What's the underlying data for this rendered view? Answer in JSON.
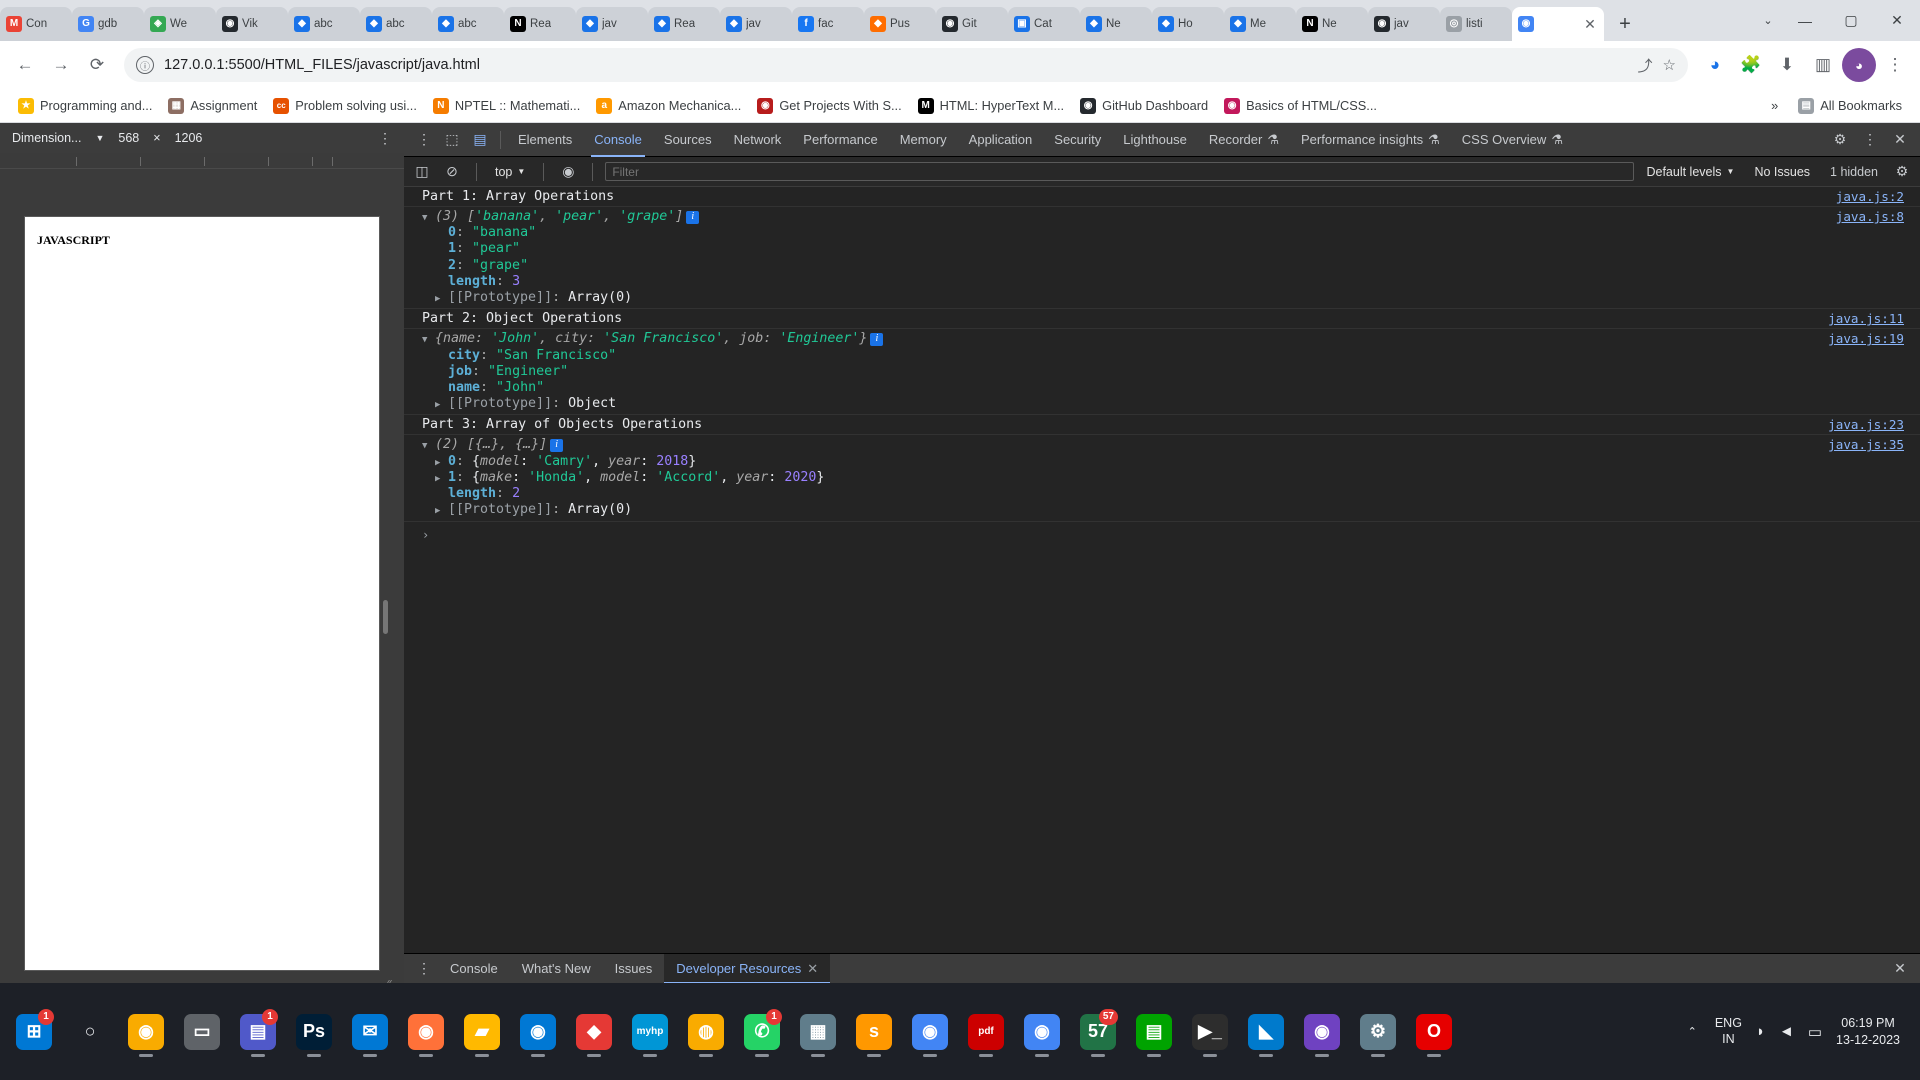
{
  "browser": {
    "tabs": [
      {
        "label": "Con",
        "icon": "M",
        "icon_color": "#ea4335",
        "active": false
      },
      {
        "label": "gdb",
        "icon": "G",
        "icon_color": "#4285f4",
        "active": false
      },
      {
        "label": "We",
        "icon": "◈",
        "icon_color": "#34a853",
        "active": false
      },
      {
        "label": "Vik",
        "icon": "◉",
        "icon_color": "#24292e",
        "active": false
      },
      {
        "label": "abc",
        "icon": "◆",
        "icon_color": "#1a73e8",
        "active": false
      },
      {
        "label": "abc",
        "icon": "◆",
        "icon_color": "#1a73e8",
        "active": false
      },
      {
        "label": "abc",
        "icon": "◆",
        "icon_color": "#1a73e8",
        "active": false
      },
      {
        "label": "Rea",
        "icon": "N",
        "icon_color": "#000000",
        "active": false
      },
      {
        "label": "jav",
        "icon": "◆",
        "icon_color": "#1a73e8",
        "active": false
      },
      {
        "label": "Rea",
        "icon": "◆",
        "icon_color": "#1a73e8",
        "active": false
      },
      {
        "label": "jav",
        "icon": "◆",
        "icon_color": "#1a73e8",
        "active": false
      },
      {
        "label": "fac",
        "icon": "f",
        "icon_color": "#1877f2",
        "active": false
      },
      {
        "label": "Pus",
        "icon": "◆",
        "icon_color": "#ff6d00",
        "active": false
      },
      {
        "label": "Git",
        "icon": "◉",
        "icon_color": "#24292e",
        "active": false
      },
      {
        "label": "Cat",
        "icon": "▣",
        "icon_color": "#1a73e8",
        "active": false
      },
      {
        "label": "Ne",
        "icon": "◆",
        "icon_color": "#1a73e8",
        "active": false
      },
      {
        "label": "Ho",
        "icon": "◆",
        "icon_color": "#1a73e8",
        "active": false
      },
      {
        "label": "Me",
        "icon": "◆",
        "icon_color": "#1a73e8",
        "active": false
      },
      {
        "label": "Ne",
        "icon": "N",
        "icon_color": "#000000",
        "active": false
      },
      {
        "label": "jav",
        "icon": "◉",
        "icon_color": "#24292e",
        "active": false
      },
      {
        "label": "listi",
        "icon": "◎",
        "icon_color": "#9aa0a6",
        "active": false
      },
      {
        "label": "",
        "icon": "◉",
        "icon_color": "#4285f4",
        "active": true
      }
    ],
    "new_tab_label": "+",
    "tab_close_label": "✕",
    "tab_search_caret": "⌄",
    "window_controls": {
      "minimize": "—",
      "maximize": "▢",
      "close": "✕"
    },
    "nav": {
      "back": "←",
      "forward": "→",
      "reload": "⟳"
    },
    "omnibox": {
      "url": "127.0.0.1:5500/HTML_FILES/javascript/java.html",
      "lock_icon": "ⓘ",
      "share_icon": "⤴",
      "star_icon": "☆",
      "profile_icon": "◕",
      "extensions_icon": "🧩",
      "download_icon": "⬇",
      "sidepanel_icon": "▥",
      "menu_icon": "⋮"
    },
    "bookmarks": [
      {
        "label": "Programming and...",
        "icon": "★",
        "color": "#fbbc04"
      },
      {
        "label": "Assignment",
        "icon": "▦",
        "color": "#8d6e63"
      },
      {
        "label": "Problem solving usi...",
        "icon": "cc",
        "color": "#e65100"
      },
      {
        "label": "NPTEL :: Mathemati...",
        "icon": "N",
        "color": "#f57c00"
      },
      {
        "label": "Amazon Mechanica...",
        "icon": "a",
        "color": "#ff9900"
      },
      {
        "label": "Get Projects With S...",
        "icon": "◉",
        "color": "#b71c1c"
      },
      {
        "label": "HTML: HyperText M...",
        "icon": "M",
        "color": "#000000"
      },
      {
        "label": "GitHub Dashboard",
        "icon": "◉",
        "color": "#24292e"
      },
      {
        "label": "Basics of HTML/CSS...",
        "icon": "◉",
        "color": "#c2185b"
      }
    ],
    "bookmarks_overflow": "»",
    "all_bookmarks_label": "All Bookmarks"
  },
  "device_toolbar": {
    "dimension_label": "Dimension...",
    "caret": "▼",
    "width": "568",
    "times": "×",
    "height": "1206",
    "kebab": "⋮"
  },
  "viewport": {
    "heading": "JAVASCRIPT"
  },
  "devtools": {
    "inspect_icon": "⬚",
    "device_icon": "▤",
    "tabs": [
      {
        "label": "Elements",
        "active": false
      },
      {
        "label": "Console",
        "active": true
      },
      {
        "label": "Sources",
        "active": false
      },
      {
        "label": "Network",
        "active": false
      },
      {
        "label": "Performance",
        "active": false
      },
      {
        "label": "Memory",
        "active": false
      },
      {
        "label": "Application",
        "active": false
      },
      {
        "label": "Security",
        "active": false
      },
      {
        "label": "Lighthouse",
        "active": false
      },
      {
        "label": "Recorder",
        "active": false,
        "badge": "⚗"
      },
      {
        "label": "Performance insights",
        "active": false,
        "badge": "⚗"
      },
      {
        "label": "CSS Overview",
        "active": false,
        "badge": "⚗"
      }
    ],
    "settings_icon": "⚙",
    "more_icon": "⋮",
    "close_icon": "✕",
    "filterbar": {
      "sidebar_icon": "◫",
      "clear_icon": "⊘",
      "context": "top",
      "context_caret": "▼",
      "eye_icon": "◉",
      "filter_placeholder": "Filter",
      "levels_label": "Default levels",
      "levels_caret": "▼",
      "issues_label": "No Issues",
      "hidden_label": "1 hidden",
      "hidden_gear": "⚙"
    },
    "console": {
      "prompt_arrow": "›",
      "arrow_down": "▼",
      "arrow_right": "▶",
      "info_badge": "i",
      "entries": [
        {
          "kind": "text",
          "text": "Part 1: Array Operations",
          "source": "java.js:2"
        },
        {
          "kind": "array",
          "header_count": "(3)",
          "header_preview": "['banana', 'pear', 'grape']",
          "source": "java.js:8",
          "items": [
            {
              "key": "0",
              "value": "\"banana\"",
              "vtype": "string"
            },
            {
              "key": "1",
              "value": "\"pear\"",
              "vtype": "string"
            },
            {
              "key": "2",
              "value": "\"grape\"",
              "vtype": "string"
            },
            {
              "key": "length",
              "value": "3",
              "vtype": "number"
            }
          ],
          "prototype_label": "[[Prototype]]",
          "prototype_value": "Array(0)"
        },
        {
          "kind": "text",
          "text": "Part 2: Object Operations",
          "source": "java.js:11"
        },
        {
          "kind": "object",
          "header_preview": "{name: 'John', city: 'San Francisco', job: 'Engineer'}",
          "source": "java.js:19",
          "items": [
            {
              "key": "city",
              "value": "\"San Francisco\"",
              "vtype": "string"
            },
            {
              "key": "job",
              "value": "\"Engineer\"",
              "vtype": "string"
            },
            {
              "key": "name",
              "value": "\"John\"",
              "vtype": "string"
            }
          ],
          "prototype_label": "[[Prototype]]",
          "prototype_value": "Object"
        },
        {
          "kind": "text",
          "text": "Part 3: Array of Objects Operations",
          "source": "java.js:23"
        },
        {
          "kind": "array_of_objects",
          "header_count": "(2)",
          "header_preview": "[{…}, {…}]",
          "source": "java.js:35",
          "rows": [
            {
              "key": "0",
              "preview": "{model: 'Camry', year: 2018}"
            },
            {
              "key": "1",
              "preview": "{make: 'Honda', model: 'Accord', year: 2020}"
            }
          ],
          "length_key": "length",
          "length_value": "2",
          "prototype_label": "[[Prototype]]",
          "prototype_value": "Array(0)"
        }
      ]
    },
    "drawer": {
      "kebab": "⋮",
      "tabs": [
        {
          "label": "Console",
          "active": false,
          "closable": false
        },
        {
          "label": "What's New",
          "active": false,
          "closable": false
        },
        {
          "label": "Issues",
          "active": false,
          "closable": false
        },
        {
          "label": "Developer Resources",
          "active": true,
          "closable": true
        }
      ],
      "close_icon": "✕",
      "drawer_close_icon": "✕"
    }
  },
  "taskbar": {
    "items": [
      {
        "name": "start-windows",
        "glyph": "⊞",
        "color": "#0078d4",
        "badge": "1",
        "running": false
      },
      {
        "name": "search",
        "glyph": "○",
        "color": "transparent",
        "running": false
      },
      {
        "name": "chrome-canary",
        "glyph": "◉",
        "color": "#f9ab00",
        "running": true
      },
      {
        "name": "task-view",
        "glyph": "▭",
        "color": "#5f6368",
        "running": false
      },
      {
        "name": "teams",
        "glyph": "▤",
        "color": "#5059c9",
        "badge": "1",
        "running": true
      },
      {
        "name": "photoshop",
        "glyph": "Ps",
        "color": "#001e36",
        "running": true
      },
      {
        "name": "mail",
        "glyph": "✉",
        "color": "#0078d4",
        "running": true
      },
      {
        "name": "firefox",
        "glyph": "◉",
        "color": "#ff7139",
        "running": true
      },
      {
        "name": "file-explorer",
        "glyph": "▰",
        "color": "#ffb900",
        "running": true
      },
      {
        "name": "edge",
        "glyph": "◉",
        "color": "#0078d4",
        "running": true
      },
      {
        "name": "gem-app",
        "glyph": "◆",
        "color": "#e53935",
        "running": true
      },
      {
        "name": "myhp",
        "glyph": "myhp",
        "color": "#0096d6",
        "running": true
      },
      {
        "name": "globe-app",
        "glyph": "◍",
        "color": "#f9ab00",
        "running": true
      },
      {
        "name": "whatsapp",
        "glyph": "✆",
        "color": "#25d366",
        "badge": "1",
        "running": true
      },
      {
        "name": "calculator",
        "glyph": "▦",
        "color": "#607d8b",
        "running": true
      },
      {
        "name": "sublime",
        "glyph": "s",
        "color": "#ff9800",
        "running": true
      },
      {
        "name": "chrome",
        "glyph": "◉",
        "color": "#4285f4",
        "running": true
      },
      {
        "name": "pdf-reader",
        "glyph": "pdf",
        "color": "#cc0000",
        "running": true
      },
      {
        "name": "chrome-active",
        "glyph": "◉",
        "color": "#4285f4",
        "running": true
      },
      {
        "name": "excel",
        "glyph": "57",
        "color": "#217346",
        "badge": "57",
        "running": true
      },
      {
        "name": "notes",
        "glyph": "▤",
        "color": "#00a300",
        "running": true
      },
      {
        "name": "terminal",
        "glyph": "▶_",
        "color": "#2d2d2d",
        "running": true
      },
      {
        "name": "vscode",
        "glyph": "◣",
        "color": "#007acc",
        "running": true
      },
      {
        "name": "github-desktop",
        "glyph": "◉",
        "color": "#6f42c1",
        "running": true
      },
      {
        "name": "settings",
        "glyph": "⚙",
        "color": "#607d8b",
        "running": true
      },
      {
        "name": "opera",
        "glyph": "O",
        "color": "#e60000",
        "running": true
      }
    ],
    "overflow_caret": "⌃",
    "lang_line1": "ENG",
    "lang_line2": "IN",
    "wifi_icon": "◗",
    "volume_icon": "◄",
    "battery_icon": "▭",
    "time": "06:19 PM",
    "date": "13-12-2023"
  }
}
